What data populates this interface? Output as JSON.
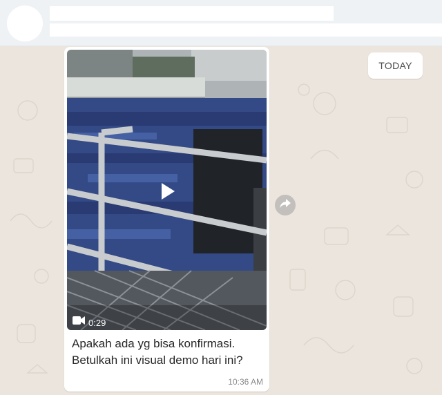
{
  "date_chip": {
    "label": "TODAY"
  },
  "message": {
    "caption_line1": "Apakah ada yg bisa konfirmasi.",
    "caption_line2": "Betulkah ini visual demo hari ini?",
    "time": "10:36 AM",
    "video": {
      "duration": "0:29"
    }
  },
  "icons": {
    "play": "play-icon",
    "camera": "video-camera-icon",
    "forward": "forward-icon"
  },
  "colors": {
    "chat_background": "#ece5dd",
    "header_background": "#eff2f4",
    "bubble": "#ffffff"
  }
}
